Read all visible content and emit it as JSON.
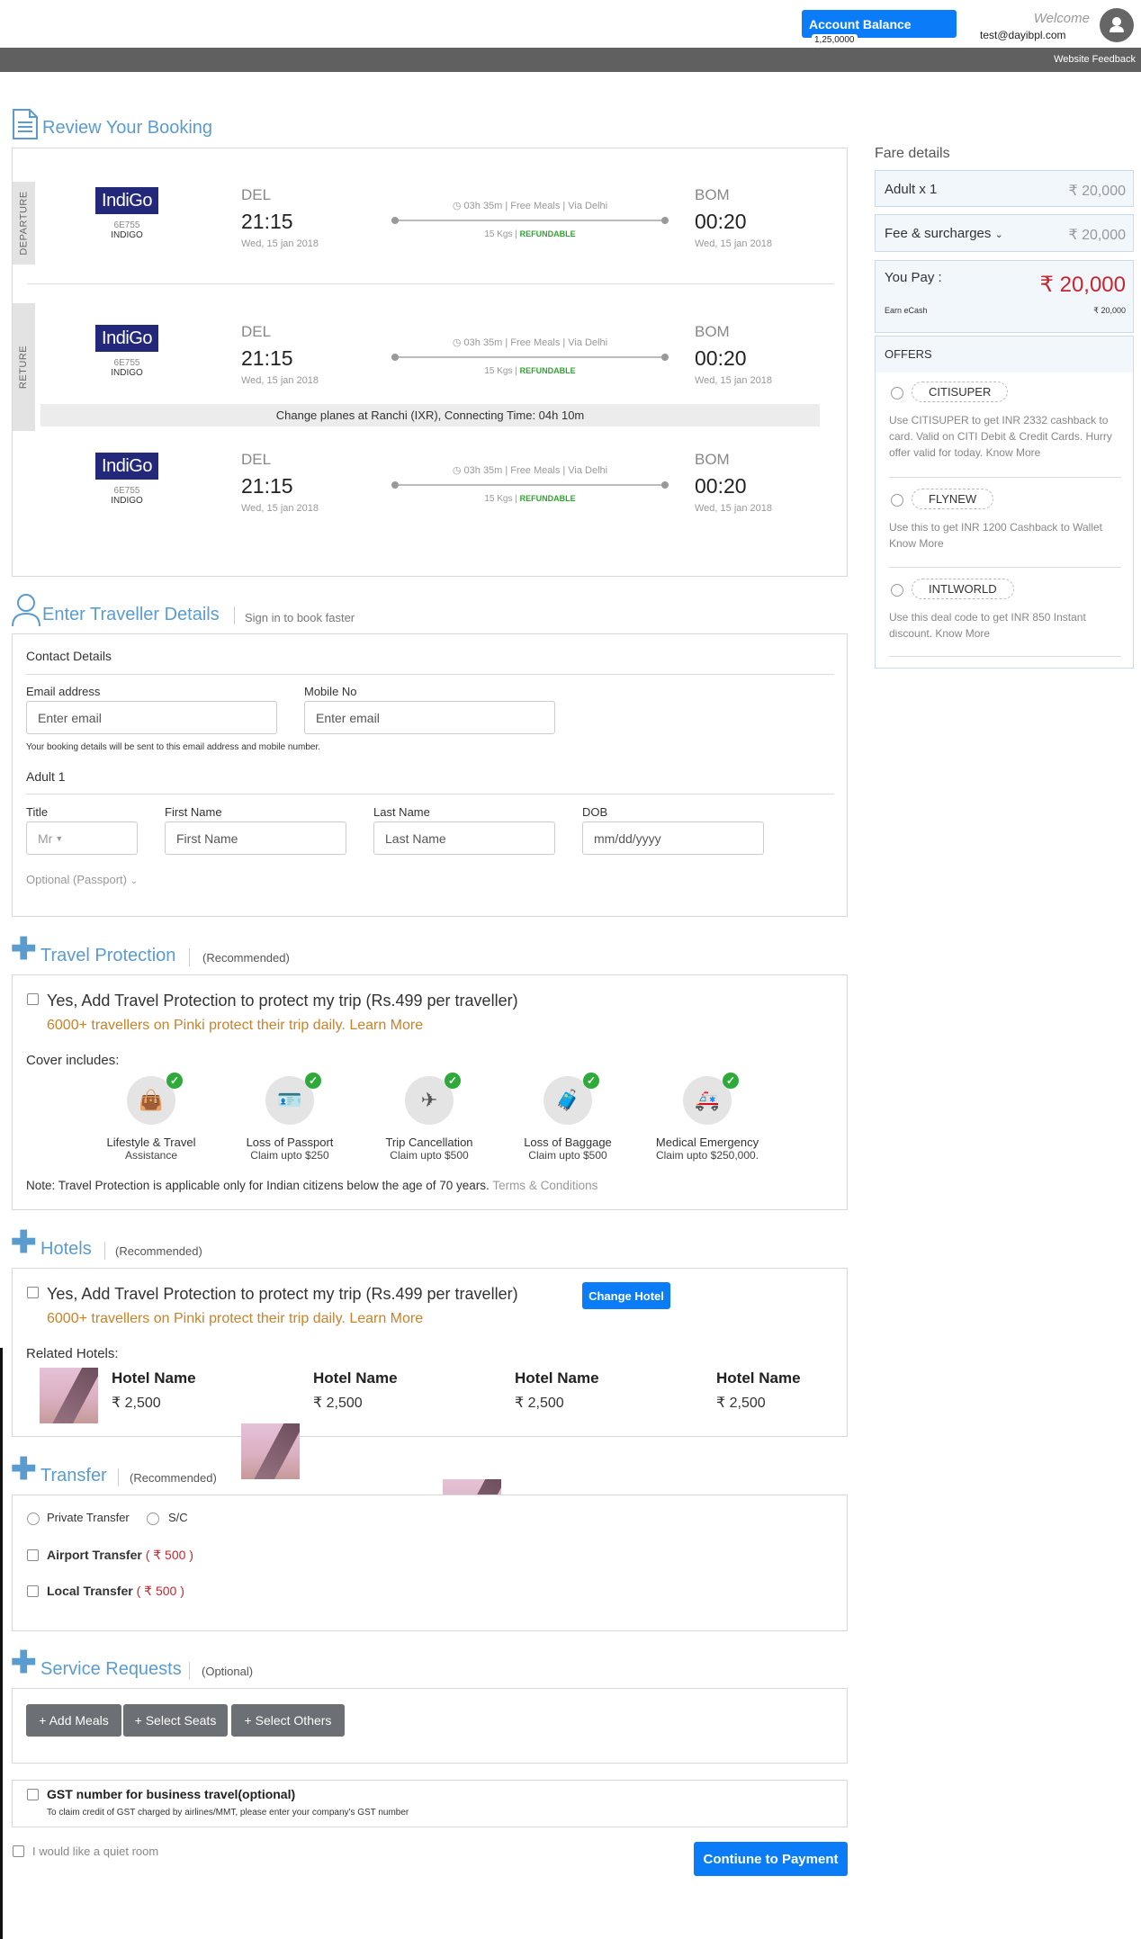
{
  "header": {
    "account_balance_label": "Account Balance",
    "account_balance_value": "1,25,0000",
    "welcome": "Welcome",
    "email": "test@dayibpl.com",
    "website_feedback": "Website Feedback"
  },
  "review": {
    "title": "Review Your Booking",
    "departure_tab": "DEPARTURE",
    "return_tab": "RETURE",
    "flights": [
      {
        "logo": "IndiGo",
        "code": "6E755",
        "airline": "INDIGO",
        "from": "DEL",
        "dep_time": "21:15",
        "dep_date": "Wed, 15 jan 2018",
        "info": "03h 35m | Free Meals | Via Delhi",
        "baggage": "15 Kgs |",
        "refund": "REFUNDABLE",
        "to": "BOM",
        "arr_time": "00:20",
        "arr_date": "Wed, 15 jan 2018"
      },
      {
        "logo": "IndiGo",
        "code": "6E755",
        "airline": "INDIGO",
        "from": "DEL",
        "dep_time": "21:15",
        "dep_date": "Wed, 15 jan 2018",
        "info": "03h 35m | Free Meals | Via Delhi",
        "baggage": "15 Kgs |",
        "refund": "REFUNDABLE",
        "to": "BOM",
        "arr_time": "00:20",
        "arr_date": "Wed, 15 jan 2018"
      },
      {
        "logo": "IndiGo",
        "code": "6E755",
        "airline": "INDIGO",
        "from": "DEL",
        "dep_time": "21:15",
        "dep_date": "Wed, 15 jan 2018",
        "info": "03h 35m | Free Meals | Via Delhi",
        "baggage": "15 Kgs |",
        "refund": "REFUNDABLE",
        "to": "BOM",
        "arr_time": "00:20",
        "arr_date": "Wed, 15 jan 2018"
      }
    ],
    "layover": "Change planes at Ranchi (IXR), Connecting Time: 04h 10m"
  },
  "traveller": {
    "title": "Enter Traveller Details",
    "signin": "Sign in to book faster",
    "contact_heading": "Contact Details",
    "email_label": "Email address",
    "email_placeholder": "Enter email",
    "mobile_label": "Mobile No",
    "mobile_placeholder": "Enter email",
    "note": "Your booking details will be sent to this email address and mobile number.",
    "adult_heading": "Adult 1",
    "title_label": "Title",
    "title_value": "Mr",
    "first_label": "First Name",
    "first_placeholder": "First Name",
    "last_label": "Last Name",
    "last_placeholder": "Last Name",
    "dob_label": "DOB",
    "dob_placeholder": "mm/dd/yyyy",
    "optional": "Optional (Passport)"
  },
  "protection": {
    "title": "Travel Protection",
    "tag": "(Recommended)",
    "option": "Yes, Add Travel Protection to protect my trip (Rs.499 per traveller)",
    "promo": "6000+ travellers on Pinki protect their trip daily. Learn More",
    "cover_label": "Cover includes:",
    "covers": [
      {
        "icon": "lifestyle-icon",
        "title": "Lifestyle & Travel",
        "sub": "Assistance"
      },
      {
        "icon": "passport-icon",
        "title": "Loss of Passport",
        "sub": "Claim upto $250"
      },
      {
        "icon": "plane-icon",
        "title": "Trip Cancellation",
        "sub": "Claim upto $500"
      },
      {
        "icon": "baggage-icon",
        "title": "Loss of Baggage",
        "sub": "Claim upto $500"
      },
      {
        "icon": "ambulance-icon",
        "title": "Medical Emergency",
        "sub": "Claim upto $250,000."
      }
    ],
    "note": "Note: Travel Protection is applicable only for Indian citizens below the age of 70 years.",
    "terms": "Terms & Conditions"
  },
  "hotels": {
    "title": "Hotels",
    "tag": "(Recommended)",
    "option": "Yes, Add Travel Protection to protect my trip (Rs.499 per traveller)",
    "promo": "6000+ travellers on Pinki protect their trip daily. Learn More",
    "change_button": "Change Hotel",
    "related_label": "Related Hotels:",
    "items": [
      {
        "name": "Hotel Name",
        "price": "₹ 2,500"
      },
      {
        "name": "Hotel Name",
        "price": "₹ 2,500"
      },
      {
        "name": "Hotel Name",
        "price": "₹ 2,500"
      },
      {
        "name": "Hotel Name",
        "price": "₹ 2,500"
      }
    ]
  },
  "transfer": {
    "title": "Transfer",
    "tag": "(Recommended)",
    "private": "Private Transfer",
    "sc": "S/C",
    "airport": "Airport Transfer",
    "airport_price": "( ₹ 500 )",
    "local": "Local Transfer",
    "local_price": "( ₹ 500 )"
  },
  "service": {
    "title": "Service Requests",
    "tag": "(Optional)",
    "meals": "+ Add Meals",
    "seats": "+ Select Seats",
    "others": "+ Select Others"
  },
  "gst": {
    "label": "GST number for business travel(optional)",
    "sub": "To claim credit of GST charged by airlines/MMT, please enter your company's GST number"
  },
  "quiet_room": "I would like a quiet room",
  "continue_button": "Contiune to Payment",
  "fare": {
    "title": "Fare details",
    "adult_label": "Adult x 1",
    "adult_value": "₹ 20,000",
    "fee_label": "Fee & surcharges",
    "fee_value": "₹ 20,000",
    "pay_label": "You Pay :",
    "pay_value": "₹ 20,000",
    "ecash_label": "Earn eCash",
    "ecash_value": "₹ 20,000",
    "offers_title": "OFFERS",
    "offers": [
      {
        "code": "CITISUPER",
        "desc": "Use CITISUPER to get INR 2332 cashback to card. Valid on CITI Debit & Credit Cards. Hurry offer valid for today.",
        "link": "Know More"
      },
      {
        "code": "FLYNEW",
        "desc": "Use this to get INR 1200 Cashback to Wallet",
        "link": "Know More"
      },
      {
        "code": "INTLWORLD",
        "desc": "Use this deal code to get INR 850 Instant discount.",
        "link": "Know More"
      }
    ]
  },
  "colors": {
    "accent": "#0a7cf7",
    "section_title": "#5a9ccf",
    "price_red": "#c9252c",
    "refundable": "#2fa52f",
    "promo": "#c8822a"
  }
}
